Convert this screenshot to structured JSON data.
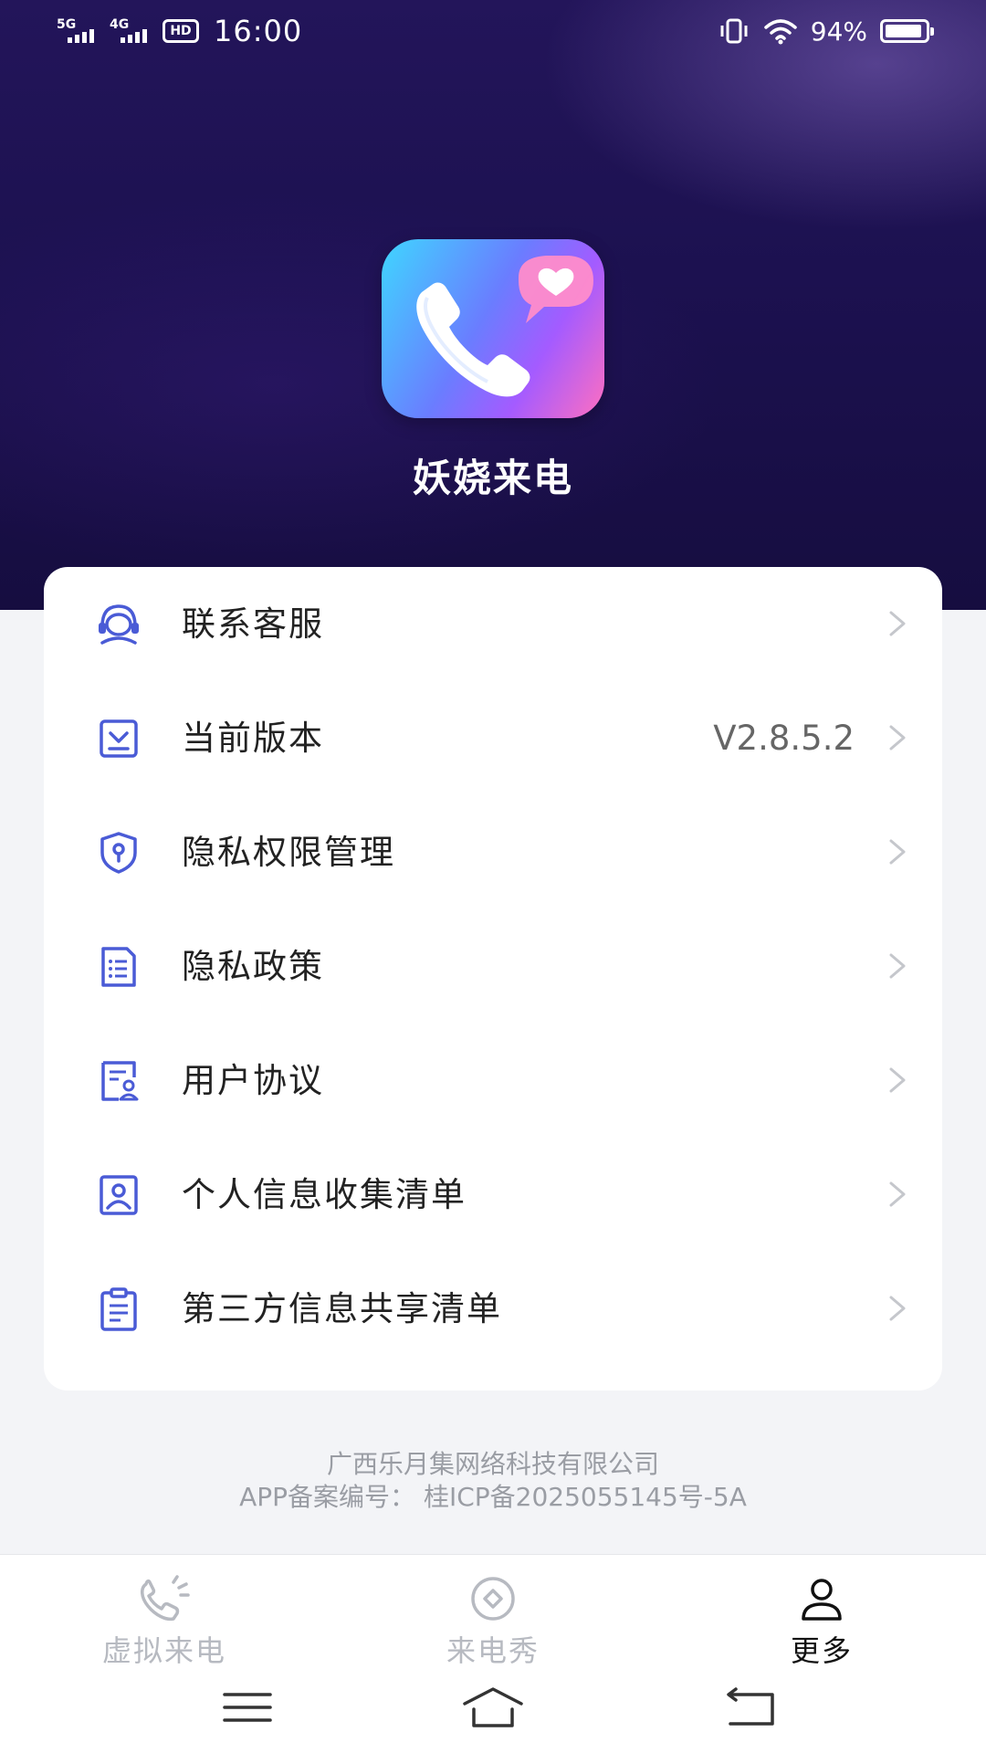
{
  "status_bar": {
    "signal_1_label": "5G",
    "signal_2_label": "4G",
    "hd_label": "HD",
    "time": "16:00",
    "battery_percent": "94%",
    "battery_level": 0.94
  },
  "header": {
    "app_name": "妖娆来电",
    "logo_icon": "phone-heart-app-icon"
  },
  "menu": {
    "items": [
      {
        "label": "联系客服",
        "icon": "customer-service-icon",
        "value": ""
      },
      {
        "label": "当前版本",
        "icon": "version-download-icon",
        "value": "V2.8.5.2"
      },
      {
        "label": "隐私权限管理",
        "icon": "privacy-shield-icon",
        "value": ""
      },
      {
        "label": "隐私政策",
        "icon": "document-list-icon",
        "value": ""
      },
      {
        "label": "用户协议",
        "icon": "user-agreement-icon",
        "value": ""
      },
      {
        "label": "个人信息收集清单",
        "icon": "personal-info-icon",
        "value": ""
      },
      {
        "label": "第三方信息共享清单",
        "icon": "clipboard-list-icon",
        "value": ""
      }
    ]
  },
  "footer": {
    "company": "广西乐月集网络科技有限公司",
    "icp": "APP备案编号：  桂ICP备2025055145号-5A"
  },
  "bottom_nav": {
    "items": [
      {
        "label": "虚拟来电",
        "icon": "incoming-call-icon",
        "active": false
      },
      {
        "label": "来电秀",
        "icon": "call-show-icon",
        "active": false
      },
      {
        "label": "更多",
        "icon": "person-icon",
        "active": true
      }
    ]
  },
  "colors": {
    "header_bg": "#1c1150",
    "accent_blue": "#4a5bd6",
    "active_nav": "#111111",
    "inactive_nav": "#b7bac1",
    "page_bg": "#f3f4f7"
  }
}
